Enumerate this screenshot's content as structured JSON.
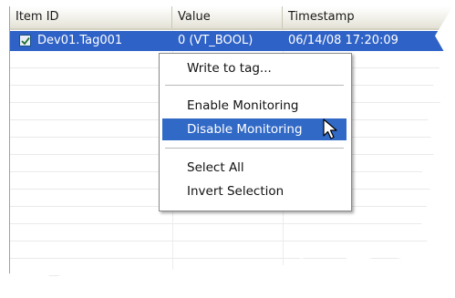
{
  "columns": {
    "item_id": "Item ID",
    "value": "Value",
    "timestamp": "Timestamp"
  },
  "selected_row": {
    "item_id": "Dev01.Tag001",
    "value": "0 (VT_BOOL)",
    "timestamp": "06/14/08 17:20:09"
  },
  "context_menu": {
    "write_to_tag": "Write to tag...",
    "enable_monitoring": "Enable Monitoring",
    "disable_monitoring": "Disable Monitoring",
    "select_all": "Select All",
    "invert_selection": "Invert Selection"
  },
  "colors": {
    "selection": "#2f62c6",
    "menu_highlight": "#3169c6"
  }
}
